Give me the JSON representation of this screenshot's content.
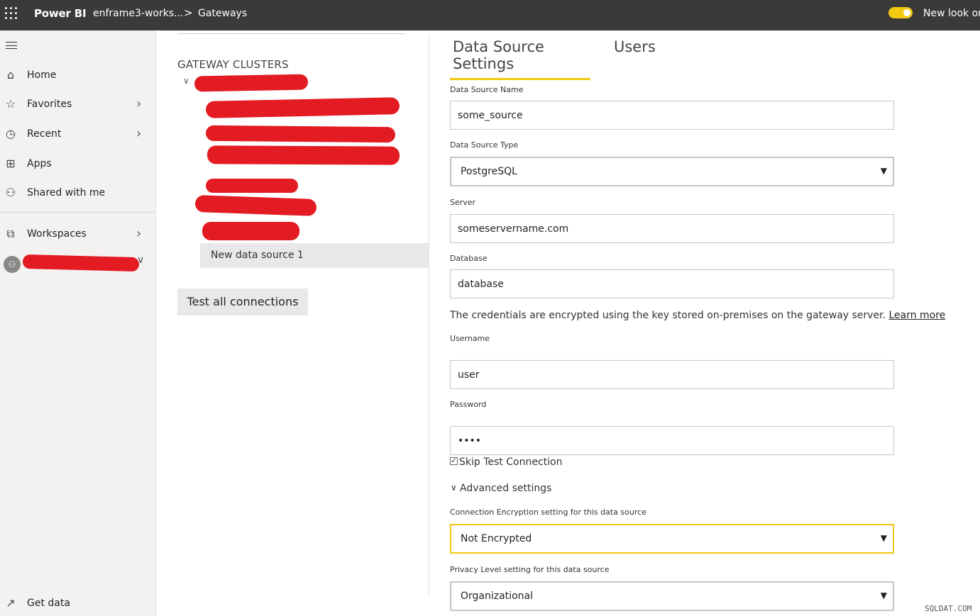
{
  "topbar": {
    "brand": "Power BI",
    "workspace": "enframe3-works...",
    "breadcrumb_sep": ">",
    "page": "Gateways",
    "new_look_label": "New look on",
    "toggle_color": "#f2c811"
  },
  "sidebar": {
    "items": [
      {
        "label": "Home",
        "icon": "home-icon",
        "glyph": "⌂"
      },
      {
        "label": "Favorites",
        "icon": "star-icon",
        "glyph": "☆"
      },
      {
        "label": "Recent",
        "icon": "clock-icon",
        "glyph": "◷"
      },
      {
        "label": "Apps",
        "icon": "apps-icon",
        "glyph": "⊞"
      },
      {
        "label": "Shared with me",
        "icon": "shared-icon",
        "glyph": "⚇"
      },
      {
        "label": "Workspaces",
        "icon": "workspaces-icon",
        "glyph": "⧉"
      }
    ],
    "get_data_label": "Get data",
    "get_data_glyph": "↗"
  },
  "gateway_panel": {
    "heading": "GATEWAY CLUSTERS",
    "selected_source": "New data source 1",
    "test_button": "Test all connections"
  },
  "tabs": {
    "settings": "Data Source Settings",
    "users": "Users"
  },
  "form": {
    "name_label": "Data Source Name",
    "name_value": "some_source",
    "type_label": "Data Source Type",
    "type_value": "PostgreSQL",
    "server_label": "Server",
    "server_value": "someservername.com",
    "database_label": "Database",
    "database_value": "database",
    "credentials_text": "The credentials are encrypted using the key stored on-premises on the gateway server. ",
    "learn_more": "Learn more",
    "username_label": "Username",
    "username_value": "user",
    "password_label": "Password",
    "password_value": "••••",
    "skip_test_label": "Skip Test Connection",
    "skip_test_checked": true,
    "advanced_label": "Advanced settings",
    "encryption_label": "Connection Encryption setting for this data source",
    "encryption_value": "Not Encrypted",
    "privacy_label": "Privacy Level setting for this data source",
    "privacy_value": "Organizational"
  },
  "watermark": "SQLDAT.COM",
  "colors": {
    "accent": "#f2c811",
    "topbar": "#3b3a39",
    "redaction": "#e31b23"
  }
}
